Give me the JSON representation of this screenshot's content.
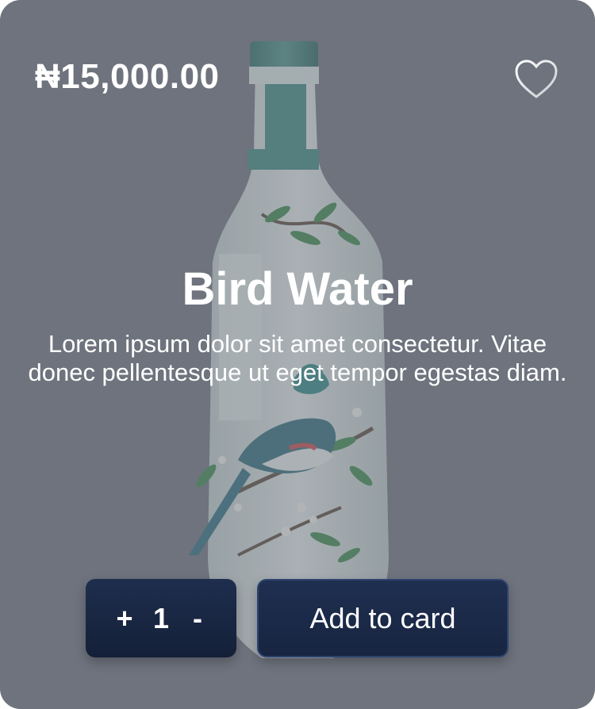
{
  "product": {
    "price": "₦15,000.00",
    "name": "Bird Water",
    "description": "Lorem ipsum dolor sit amet consectetur. Vitae donec pellentesque ut eget tempor egestas diam.",
    "image": "bird-water-bottle",
    "favorite_icon": "heart-outline-icon"
  },
  "quantity": {
    "plus_label": "+",
    "value": "1",
    "minus_label": "-"
  },
  "actions": {
    "add_label": "Add to card"
  },
  "colors": {
    "card_background": "#70757f",
    "button_background": "#1e2e4d",
    "text": "#ffffff"
  }
}
